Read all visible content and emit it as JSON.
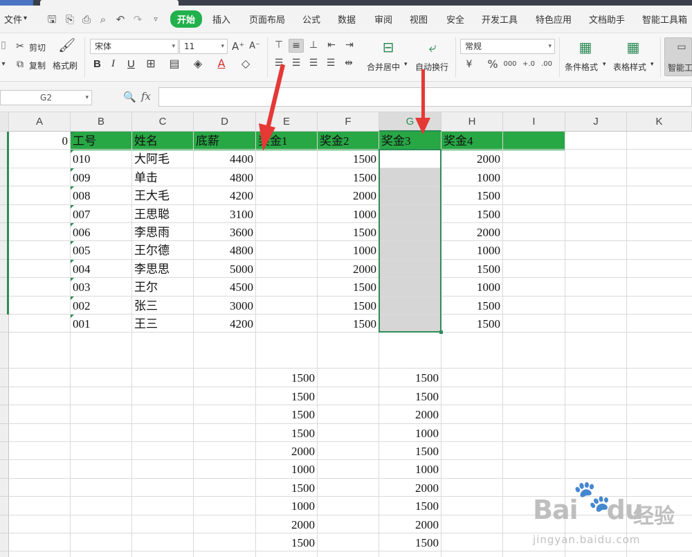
{
  "menubar": {
    "file_label": "文件",
    "tabs": [
      "开始",
      "插入",
      "页面布局",
      "公式",
      "数据",
      "审阅",
      "视图",
      "安全",
      "开发工具",
      "特色应用",
      "文档助手",
      "智能工具箱"
    ],
    "active_tab": "开始"
  },
  "ribbon": {
    "cut": "剪切",
    "copy": "复制",
    "format_painter": "格式刷",
    "font_name": "宋体",
    "font_size": "11",
    "bold": "B",
    "italic": "I",
    "underline": "U",
    "merge_center": "合并居中",
    "wrap_text": "自动换行",
    "number_format": "常规",
    "conditional_format": "条件格式",
    "table_style": "表格样式",
    "smart": "智能工"
  },
  "formula_bar": {
    "name_box": "G2",
    "fx": "fx",
    "content": ""
  },
  "columns": [
    "A",
    "B",
    "C",
    "D",
    "E",
    "F",
    "G",
    "H",
    "I",
    "J",
    "K"
  ],
  "selected_column": "G",
  "table": {
    "a1": "0",
    "headers": [
      "工号",
      "姓名",
      "底薪",
      "奖金1",
      "奖金2",
      "奖金3",
      "奖金4"
    ],
    "rows": [
      {
        "id": "010",
        "name": "大阿毛",
        "base": "4400",
        "b1": "",
        "b2": "1500",
        "b3": "",
        "b4": "2000"
      },
      {
        "id": "009",
        "name": "单击",
        "base": "4800",
        "b1": "",
        "b2": "1500",
        "b3": "",
        "b4": "1000"
      },
      {
        "id": "008",
        "name": "王大毛",
        "base": "4200",
        "b1": "",
        "b2": "2000",
        "b3": "",
        "b4": "1500"
      },
      {
        "id": "007",
        "name": "王思聪",
        "base": "3100",
        "b1": "",
        "b2": "1000",
        "b3": "",
        "b4": "1500"
      },
      {
        "id": "006",
        "name": "李思雨",
        "base": "3600",
        "b1": "",
        "b2": "1500",
        "b3": "",
        "b4": "2000"
      },
      {
        "id": "005",
        "name": "王尔德",
        "base": "4800",
        "b1": "",
        "b2": "1000",
        "b3": "",
        "b4": "1000"
      },
      {
        "id": "004",
        "name": "李思思",
        "base": "5000",
        "b1": "",
        "b2": "2000",
        "b3": "",
        "b4": "1500"
      },
      {
        "id": "003",
        "name": "王尔",
        "base": "4500",
        "b1": "",
        "b2": "1500",
        "b3": "",
        "b4": "1000"
      },
      {
        "id": "002",
        "name": "张三",
        "base": "3000",
        "b1": "",
        "b2": "1500",
        "b3": "",
        "b4": "1500"
      },
      {
        "id": "001",
        "name": "王三",
        "base": "4200",
        "b1": "",
        "b2": "1500",
        "b3": "",
        "b4": "1500"
      }
    ]
  },
  "lower_table": {
    "col_e": [
      "1500",
      "1500",
      "1500",
      "1500",
      "2000",
      "1000",
      "1500",
      "1000",
      "2000",
      "1500"
    ],
    "col_g": [
      "1500",
      "1500",
      "2000",
      "1000",
      "1500",
      "1000",
      "2000",
      "1500",
      "2000",
      "1500"
    ]
  },
  "colors": {
    "header_green": "#28a745",
    "accent": "#2e8b57",
    "arrow_red": "#e53935",
    "active_tab": "#22b14c"
  },
  "watermark": {
    "brand": "Bai",
    "brand2": "du",
    "cn": "经验",
    "url": "jingyan.baidu.com"
  }
}
